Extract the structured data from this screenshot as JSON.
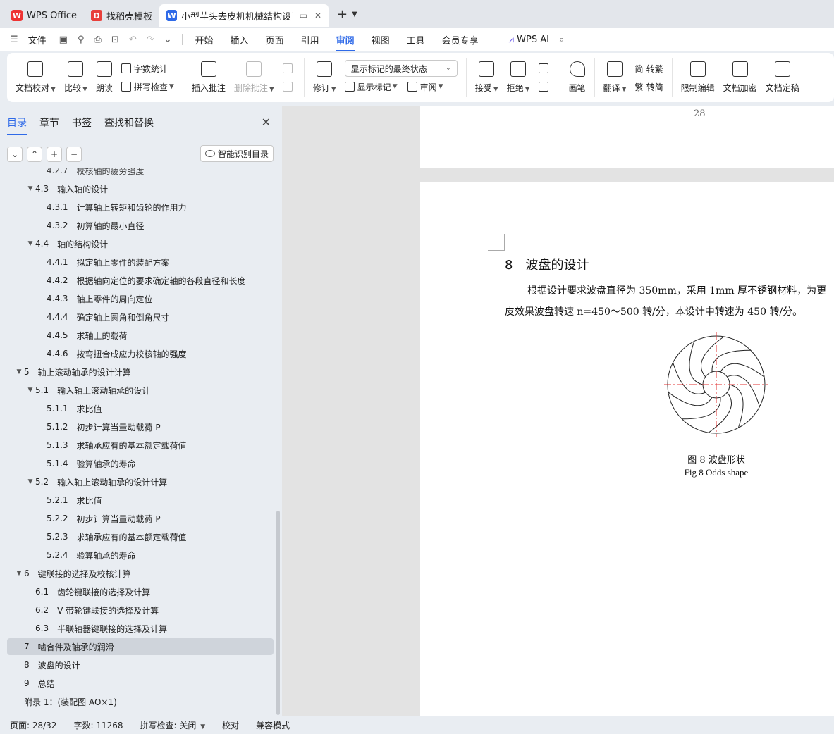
{
  "tabs": [
    {
      "label": "WPS Office",
      "icon": "wps-logo-icon"
    },
    {
      "label": "找稻壳模板",
      "icon": "docer-logo-icon"
    },
    {
      "label": "小型芋头去皮机机械结构设计",
      "icon": "writer-logo-icon",
      "active": true
    }
  ],
  "menu": {
    "file_label": "文件",
    "items": [
      "开始",
      "插入",
      "页面",
      "引用",
      "审阅",
      "视图",
      "工具",
      "会员专享"
    ],
    "active": "审阅",
    "ai_label": "WPS AI"
  },
  "ribbon": {
    "doc_proofread": "文档校对",
    "compare": "比较",
    "read_aloud": "朗读",
    "word_count": "字数统计",
    "spell_check": "拼写检查",
    "insert_comment": "插入批注",
    "delete_comment": "删除批注",
    "revise": "修订",
    "markup_state": "显示标记的最终状态",
    "show_markup": "显示标记",
    "review": "审阅",
    "accept": "接受",
    "reject": "拒绝",
    "pen": "画笔",
    "translate": "翻译",
    "to_traditional": "转繁",
    "to_simplified": "转简",
    "restrict_edit": "限制编辑",
    "encrypt": "文档加密",
    "finalize": "文档定稿"
  },
  "sidebar": {
    "tabs": [
      "目录",
      "章节",
      "书签",
      "查找和替换"
    ],
    "active_tab": "目录",
    "smart_toc": "智能识别目录",
    "toc": [
      {
        "num": "4.2.7",
        "text": "校核轴的疲劳强度",
        "level": 3,
        "clipped": true
      },
      {
        "num": "4.3",
        "text": "输入轴的设计",
        "level": 2,
        "expand": true
      },
      {
        "num": "4.3.1",
        "text": "计算轴上转矩和齿轮的作用力",
        "level": 3
      },
      {
        "num": "4.3.2",
        "text": "初算轴的最小直径",
        "level": 3
      },
      {
        "num": "4.4",
        "text": "轴的结构设计",
        "level": 2,
        "expand": true
      },
      {
        "num": "4.4.1",
        "text": "拟定轴上零件的装配方案",
        "level": 3
      },
      {
        "num": "4.4.2",
        "text": "根据轴向定位的要求确定轴的各段直径和长度",
        "level": 3
      },
      {
        "num": "4.4.3",
        "text": "轴上零件的周向定位",
        "level": 3
      },
      {
        "num": "4.4.4",
        "text": "确定轴上圆角和倒角尺寸",
        "level": 3
      },
      {
        "num": "4.4.5",
        "text": "求轴上的载荷",
        "level": 3
      },
      {
        "num": "4.4.6",
        "text": "按弯扭合成应力校核轴的强度",
        "level": 3
      },
      {
        "num": "5",
        "text": "轴上滚动轴承的设计计算",
        "level": 1,
        "expand": true
      },
      {
        "num": "5.1",
        "text": "输入轴上滚动轴承的设计",
        "level": 2,
        "expand": true
      },
      {
        "num": "5.1.1",
        "text": "求比值",
        "level": 3
      },
      {
        "num": "5.1.2",
        "text": "初步计算当量动载荷 P",
        "level": 3
      },
      {
        "num": "5.1.3",
        "text": "求轴承应有的基本额定载荷值",
        "level": 3
      },
      {
        "num": "5.1.4",
        "text": "验算轴承的寿命",
        "level": 3
      },
      {
        "num": "5.2",
        "text": "输入轴上滚动轴承的设计计算",
        "level": 2,
        "expand": true
      },
      {
        "num": "5.2.1",
        "text": "求比值",
        "level": 3
      },
      {
        "num": "5.2.2",
        "text": "初步计算当量动载荷 P",
        "level": 3
      },
      {
        "num": "5.2.3",
        "text": "求轴承应有的基本额定载荷值",
        "level": 3
      },
      {
        "num": "5.2.4",
        "text": "验算轴承的寿命",
        "level": 3
      },
      {
        "num": "6",
        "text": "键联接的选择及校核计算",
        "level": 1,
        "expand": true
      },
      {
        "num": "6.1",
        "text": "齿轮键联接的选择及计算",
        "level": 2
      },
      {
        "num": "6.2",
        "text": "V 带轮键联接的选择及计算",
        "level": 2
      },
      {
        "num": "6.3",
        "text": "半联轴器键联接的选择及计算",
        "level": 2
      },
      {
        "num": "7",
        "text": "啮合件及轴承的润滑",
        "level": 1,
        "selected": true
      },
      {
        "num": "8",
        "text": "波盘的设计",
        "level": 1
      },
      {
        "num": "9",
        "text": "总结",
        "level": 1
      },
      {
        "num": "",
        "text": "附录 1：(装配图 AO×1)",
        "level": 1
      }
    ]
  },
  "document": {
    "prev_page_number": "28",
    "heading_num": "8",
    "heading_text": "波盘的设计",
    "para_line1": "根据设计要求波盘直径为 350mm，采用 1mm 厚不锈钢材料，为更",
    "para_line2": "皮效果波盘转速 n=450～500 转/分，本设计中转速为 450 转/分。",
    "fig_caption_cn": "图 8 波盘形状",
    "fig_caption_en": "Fig 8 Odds shape"
  },
  "status": {
    "page": "页面: 28/32",
    "words": "字数: 11268",
    "spell": "拼写检查: 关闭",
    "proof": "校对",
    "compat": "兼容模式"
  },
  "colors": {
    "accent": "#2f6ae8",
    "crosshair": "#e03030"
  }
}
